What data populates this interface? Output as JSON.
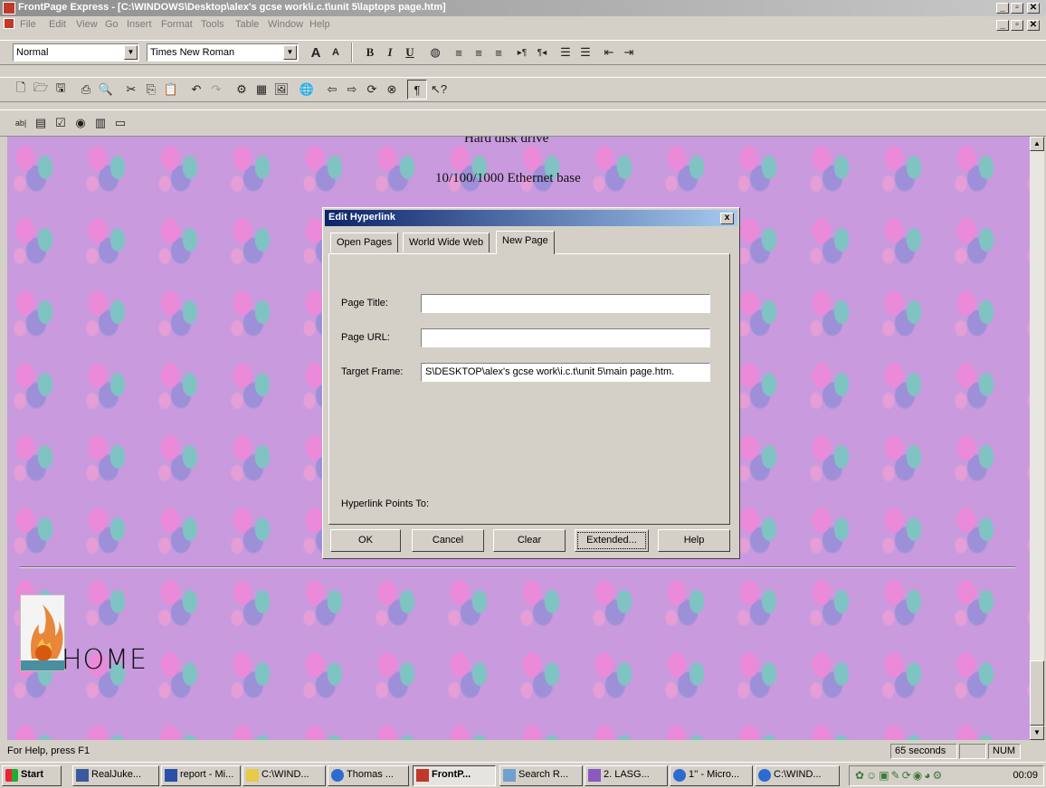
{
  "window": {
    "title": "FrontPage Express - [C:\\WINDOWS\\Desktop\\alex's gcse work\\i.c.t\\unit 5\\laptops page.htm]"
  },
  "menu": [
    "File",
    "Edit",
    "View",
    "Go",
    "Insert",
    "Format",
    "Tools",
    "Table",
    "Window",
    "Help"
  ],
  "format_toolbar": {
    "style_value": "Normal",
    "font_value": "Times New Roman"
  },
  "document": {
    "lines": [
      "Hard disk drive",
      "10/100/1000 Ethernet base"
    ],
    "home_label": "HOME"
  },
  "dialog": {
    "title": "Edit Hyperlink",
    "close": "x",
    "tabs": [
      "Open Pages",
      "World Wide Web",
      "New Page"
    ],
    "active_tab": "New Page",
    "fields": {
      "page_title_label": "Page Title:",
      "page_title_value": "",
      "page_url_label": "Page URL:",
      "page_url_value": "",
      "target_frame_label": "Target Frame:",
      "target_frame_value": "S\\DESKTOP\\alex's gcse work\\i.c.t\\unit 5\\main page.htm."
    },
    "points_to_label": "Hyperlink Points To:",
    "buttons": {
      "ok": "OK",
      "cancel": "Cancel",
      "clear": "Clear",
      "extended": "Extended...",
      "help": "Help"
    }
  },
  "statusbar": {
    "help_text": "For Help, press F1",
    "timer": "65 seconds",
    "num": "NUM"
  },
  "taskbar": {
    "start": "Start",
    "tasks": [
      "RealJuke...",
      "report - Mi...",
      "C:\\WIND...",
      "Thomas ...",
      "FrontP...",
      "Search R...",
      "2. LASG...",
      "1'' - Micro...",
      "C:\\WIND..."
    ],
    "clock": "00:09"
  }
}
